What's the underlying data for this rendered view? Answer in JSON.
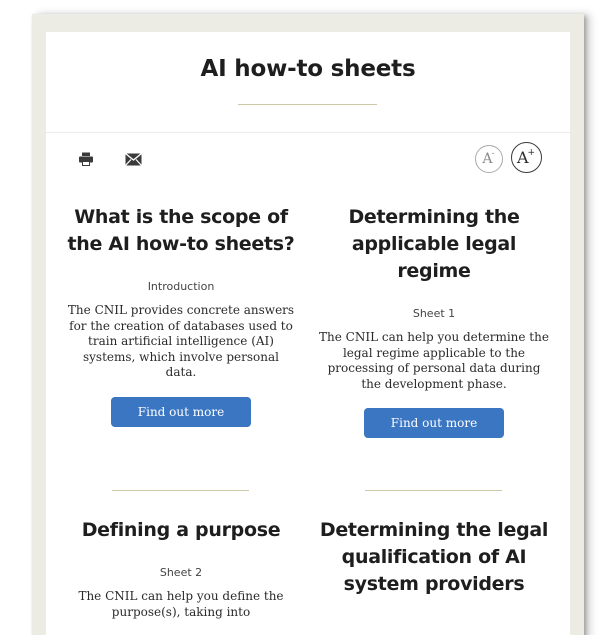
{
  "page": {
    "title": "AI how-to sheets"
  },
  "toolbar": {
    "print_icon": "print-icon",
    "mail_icon": "mail-icon",
    "decrease_label": "A",
    "decrease_symbol": "-",
    "increase_label": "A",
    "increase_symbol": "+"
  },
  "sheets": [
    {
      "title": "What is the scope of the AI how-to sheets?",
      "tag": "Introduction",
      "description": "The CNIL provides concrete answers for the creation of databases used to train artificial intelligence (AI) systems, which involve personal data.",
      "button": "Find out more"
    },
    {
      "title": "Determining the applicable legal regime",
      "tag": "Sheet 1",
      "description": "The CNIL can help you determine the legal regime applicable to the processing of personal data during the development phase.",
      "button": "Find out more"
    },
    {
      "title": "Defining a purpose",
      "tag": "Sheet 2",
      "description": "The CNIL can help you define the purpose(s), taking into"
    },
    {
      "title": "Determining the legal qualification of AI system providers"
    }
  ],
  "colors": {
    "button_blue": "#3a76c1",
    "accent_line": "#cfc8a6",
    "frame": "#ecebe4"
  }
}
